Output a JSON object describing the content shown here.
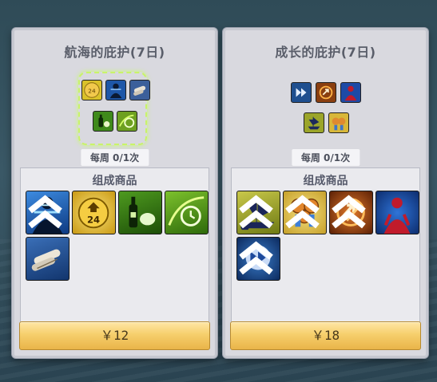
{
  "cards": [
    {
      "title": "航海的庇护(7日)",
      "limit": "每周 0/1次",
      "contents_label": "组成商品",
      "price": "￥12",
      "items": [
        {
          "icon": "sailor-figure-icon"
        },
        {
          "icon": "gold-coin-24-icon",
          "value": "24"
        },
        {
          "icon": "bottle-food-icon"
        },
        {
          "icon": "speed-clock-icon"
        },
        {
          "icon": "scroll-bundle-icon"
        }
      ]
    },
    {
      "title": "成长的庇护(7日)",
      "limit": "每周 0/1次",
      "contents_label": "组成商品",
      "price": "￥18",
      "items": [
        {
          "icon": "sailing-fleet-icon"
        },
        {
          "icon": "medals-icon"
        },
        {
          "icon": "orange-arrow-boost-icon"
        },
        {
          "icon": "red-figure-icon"
        },
        {
          "icon": "fast-forward-icon"
        }
      ]
    }
  ],
  "colors": {
    "price_gold": "#f6cf6c",
    "highlight_green": "#c9f36a"
  }
}
